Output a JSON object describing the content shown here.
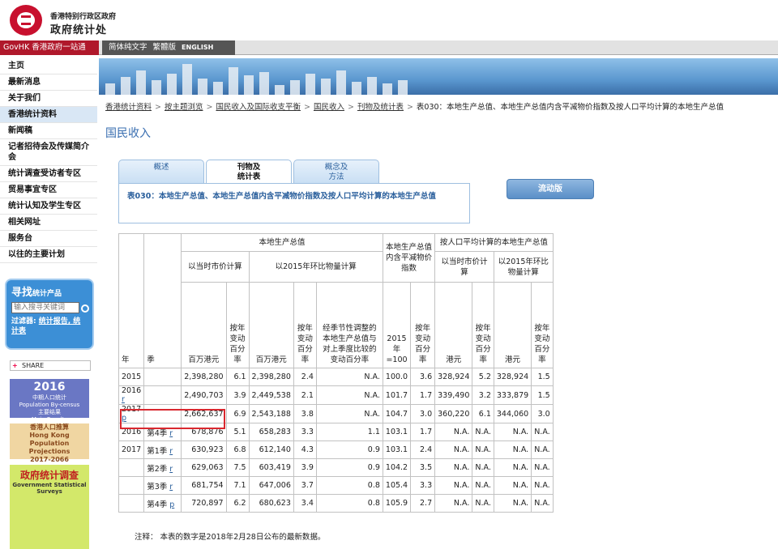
{
  "header": {
    "org_line1": "香港特别行政区政府",
    "org_line2": "政府统计处",
    "brand_color": "#c8102e"
  },
  "topbar": {
    "govhk": "GovHK 香港政府一站通",
    "langs": [
      "简体纯文字",
      "繁體版",
      "ENGLISH"
    ]
  },
  "nav": {
    "items": [
      "主页",
      "最新消息",
      "关于我们",
      "香港统计资料",
      "新闻稿",
      "记者招待会及传媒简介会",
      "统计调查受访者专区",
      "贸易事宜专区",
      "统计认知及学生专区",
      "相关网址",
      "服务台",
      "以往的主要计划"
    ],
    "active_index": 3
  },
  "search": {
    "title": "寻找",
    "subtitle": "统计产品",
    "placeholder": "输入搜寻关键词",
    "filter_label": "过滤器:",
    "filter_links": "统计报告, 统计表"
  },
  "share": {
    "label": "SHARE"
  },
  "banners": {
    "census": {
      "year": "2016",
      "line1": "中期人口统计",
      "line2": "Population By-census",
      "line3": "主要结果",
      "line4": "Main Results"
    },
    "projection": {
      "line1": "香港人口推算",
      "line2": "Hong Kong",
      "line3": "Population Projections",
      "line4": "2017-2066"
    },
    "survey": {
      "line1": "政府统计调查",
      "line2": "Government Statistical Surveys"
    }
  },
  "breadcrumb": [
    "香港统计资料",
    "按主题浏览",
    "国民收入及国际收支平衡",
    "国民收入",
    "刊物及统计表",
    "表030：本地生产总值、本地生产总值内含平减物价指数及按人口平均计算的本地生产总值"
  ],
  "page_title": "国民收入",
  "tabs": [
    {
      "label1": "概述",
      "label2": ""
    },
    {
      "label1": "刊物及",
      "label2": "统计表"
    },
    {
      "label1": "概念及",
      "label2": "方法"
    }
  ],
  "active_tab": 1,
  "table_title": "表030：本地生产总值、本地生产总值内含平减物价指数及按人口平均计算的本地生产总值",
  "mobile_button": "流动版",
  "table": {
    "h_gdp": "本地生产总值",
    "h_deflator": "本地生产总值内含平减物价指数",
    "h_percap": "按人口平均计算的本地生产总值",
    "h_current": "以当时市价计算",
    "h_chained": "以2015年环比物量计算",
    "h_current2": "以当时市价计算",
    "h_chained2": "以2015年环比物量计算",
    "h_year": "年",
    "h_quarter": "季",
    "h_hkdm": "百万港元",
    "h_yoy": "按年变动百分率",
    "h_hkdm2": "百万港元",
    "h_yoy2": "按年变动百分率",
    "h_sa": "经季节性调整的本地生产总值与对上季度比较的变动百分率",
    "h_index": "2015年=100",
    "h_yoy3": "按年变动百分率",
    "h_hkd": "港元",
    "h_yoy4": "按年变动百分率",
    "h_hkd2": "港元",
    "h_yoy5": "按年变动百分率",
    "rows": [
      {
        "year": "2015",
        "q": "",
        "mark": "",
        "c": [
          "2,398,280",
          "6.1",
          "2,398,280",
          "2.4",
          "N.A.",
          "100.0",
          "3.6",
          "328,924",
          "5.2",
          "328,924",
          "1.5"
        ]
      },
      {
        "year": "2016",
        "q": "",
        "mark": "r",
        "c": [
          "2,490,703",
          "3.9",
          "2,449,538",
          "2.1",
          "N.A.",
          "101.7",
          "1.7",
          "339,490",
          "3.2",
          "333,879",
          "1.5"
        ]
      },
      {
        "year": "2017",
        "q": "",
        "mark": "p",
        "c": [
          "2,662,637",
          "6.9",
          "2,543,188",
          "3.8",
          "N.A.",
          "104.7",
          "3.0",
          "360,220",
          "6.1",
          "344,060",
          "3.0"
        ]
      },
      {
        "year": "2016",
        "q": "第4季",
        "mark": "r",
        "c": [
          "678,876",
          "5.1",
          "658,283",
          "3.3",
          "1.1",
          "103.1",
          "1.7",
          "N.A.",
          "N.A.",
          "N.A.",
          "N.A."
        ]
      },
      {
        "year": "2017",
        "q": "第1季",
        "mark": "r",
        "c": [
          "630,923",
          "6.8",
          "612,140",
          "4.3",
          "0.9",
          "103.1",
          "2.4",
          "N.A.",
          "N.A.",
          "N.A.",
          "N.A."
        ]
      },
      {
        "year": "",
        "q": "第2季",
        "mark": "r",
        "c": [
          "629,063",
          "7.5",
          "603,419",
          "3.9",
          "0.9",
          "104.2",
          "3.5",
          "N.A.",
          "N.A.",
          "N.A.",
          "N.A."
        ]
      },
      {
        "year": "",
        "q": "第3季",
        "mark": "r",
        "c": [
          "681,754",
          "7.1",
          "647,006",
          "3.7",
          "0.8",
          "105.4",
          "3.3",
          "N.A.",
          "N.A.",
          "N.A.",
          "N.A."
        ]
      },
      {
        "year": "",
        "q": "第4季",
        "mark": "p",
        "c": [
          "720,897",
          "6.2",
          "680,623",
          "3.4",
          "0.8",
          "105.9",
          "2.7",
          "N.A.",
          "N.A.",
          "N.A.",
          "N.A."
        ]
      }
    ]
  },
  "note": "注释：  本表的数字是2018年2月28日公布的最新数据。"
}
